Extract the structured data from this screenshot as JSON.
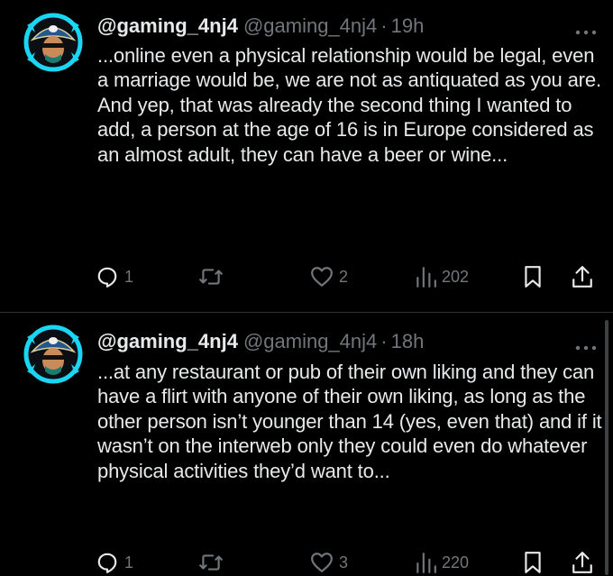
{
  "tweets": [
    {
      "display_name": "@gaming_4nj4",
      "handle": "@gaming_4nj4",
      "dot": "·",
      "time": "19h",
      "text": "...online even a physical relationship would be legal, even a marriage would be, we are not as antiquated as you are. And yep, that was already the second thing I wanted to add, a person at the age of 16 is in Europe considered as an almost adult, they can have a beer or wine...",
      "replies": "1",
      "retweets": "",
      "likes": "2",
      "views": "202"
    },
    {
      "display_name": "@gaming_4nj4",
      "handle": "@gaming_4nj4",
      "dot": "·",
      "time": "18h",
      "text": "...at any restaurant or pub of their own liking and they can have a flirt with anyone of their own liking, as long as the other person isn’t younger than 14 (yes, even that) and if it wasn’t on the interweb only they could even do whatever physical activities they’d want to...",
      "replies": "1",
      "retweets": "",
      "likes": "3",
      "views": "220"
    }
  ],
  "icons": {
    "reply": "reply-icon",
    "retweet": "retweet-icon",
    "like": "heart-icon",
    "views": "views-icon",
    "bookmark": "bookmark-icon",
    "share": "share-icon",
    "more": "more-options-icon",
    "avatar": "pirate-avatar"
  },
  "colors": {
    "background": "#000000",
    "text": "#e7e9ea",
    "secondary": "#71767b",
    "avatar_ring": "#1ad6f2"
  }
}
